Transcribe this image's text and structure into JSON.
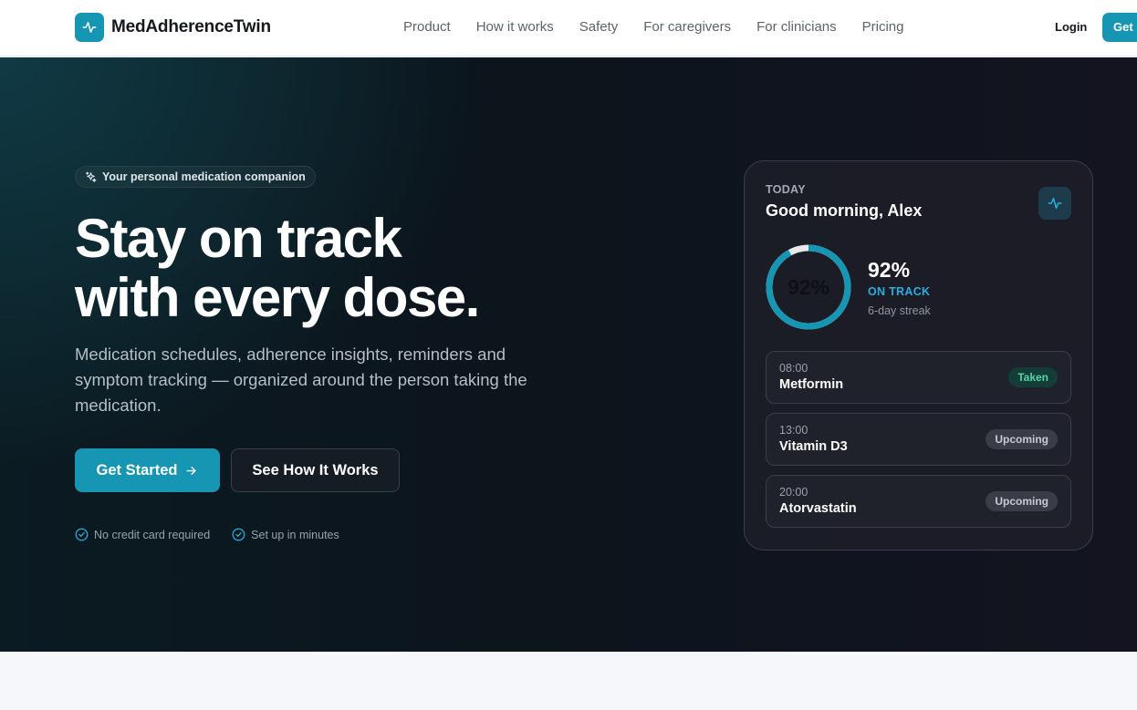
{
  "brand": {
    "name": "MedAdherenceTwin",
    "accent": "#1796b3"
  },
  "nav": {
    "items": [
      "Product",
      "How it works",
      "Safety",
      "For caregivers",
      "For clinicians",
      "Pricing"
    ],
    "login": "Login",
    "cta": "Get Started"
  },
  "hero": {
    "pill": "Your personal medication companion",
    "headline_line1": "Stay on track",
    "headline_line2": "with every dose.",
    "subtitle": "Medication schedules, adherence insights, reminders and symptom tracking — organized around the person taking the medication.",
    "primary_button": "Get Started",
    "secondary_button": "See How It Works",
    "checks": [
      "No credit card required",
      "Set up in minutes"
    ]
  },
  "card": {
    "label": "TODAY",
    "greeting": "Good morning, Alex",
    "adherence_ring_text": "92%",
    "adherence_value": "92%",
    "adherence_fraction": 0.92,
    "status": "ON TRACK",
    "streak": "6-day streak",
    "doses": [
      {
        "time": "08:00",
        "name": "Metformin",
        "badge": "Taken",
        "state": "taken"
      },
      {
        "time": "13:00",
        "name": "Vitamin D3",
        "badge": "Upcoming",
        "state": "upcoming"
      },
      {
        "time": "20:00",
        "name": "Atorvastatin",
        "badge": "Upcoming",
        "state": "upcoming"
      }
    ]
  }
}
